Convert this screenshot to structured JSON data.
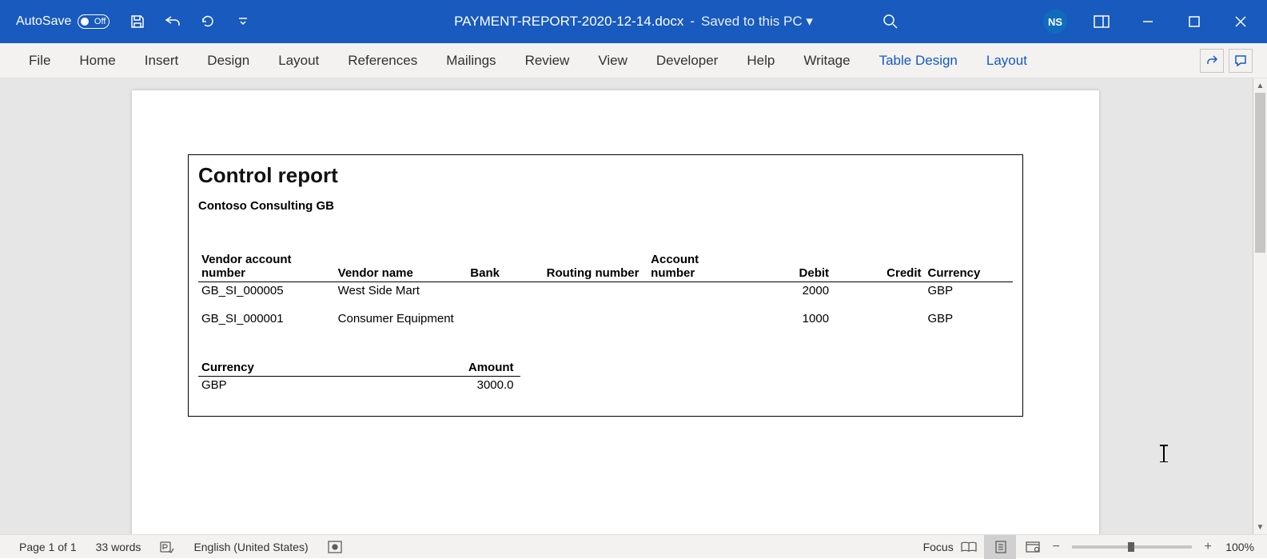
{
  "titlebar": {
    "autosave_label": "AutoSave",
    "autosave_off": "Off",
    "filename": "PAYMENT-REPORT-2020-12-14.docx",
    "save_status": "Saved to this PC",
    "user_initials": "NS"
  },
  "ribbon": {
    "tabs": [
      "File",
      "Home",
      "Insert",
      "Design",
      "Layout",
      "References",
      "Mailings",
      "Review",
      "View",
      "Developer",
      "Help",
      "Writage"
    ],
    "contextual": [
      "Table Design",
      "Layout"
    ]
  },
  "document": {
    "report_title": "Control report",
    "company": "Contoso Consulting GB",
    "headers": {
      "vendor_account": "Vendor account number",
      "vendor_name": "Vendor name",
      "bank": "Bank",
      "routing": "Routing number",
      "account": "Account number",
      "debit": "Debit",
      "credit": "Credit",
      "currency": "Currency"
    },
    "rows": [
      {
        "vendor_account": "GB_SI_000005",
        "vendor_name": "West Side Mart",
        "bank": "",
        "routing": "",
        "account": "",
        "debit": "2000",
        "credit": "",
        "currency": "GBP"
      },
      {
        "vendor_account": "GB_SI_000001",
        "vendor_name": "Consumer Equipment",
        "bank": "",
        "routing": "",
        "account": "",
        "debit": "1000",
        "credit": "",
        "currency": "GBP"
      }
    ],
    "summary_headers": {
      "currency": "Currency",
      "amount": "Amount"
    },
    "summary_rows": [
      {
        "currency": "GBP",
        "amount": "3000.0"
      }
    ]
  },
  "statusbar": {
    "page": "Page 1 of 1",
    "words": "33 words",
    "language": "English (United States)",
    "focus": "Focus",
    "zoom": "100%"
  }
}
